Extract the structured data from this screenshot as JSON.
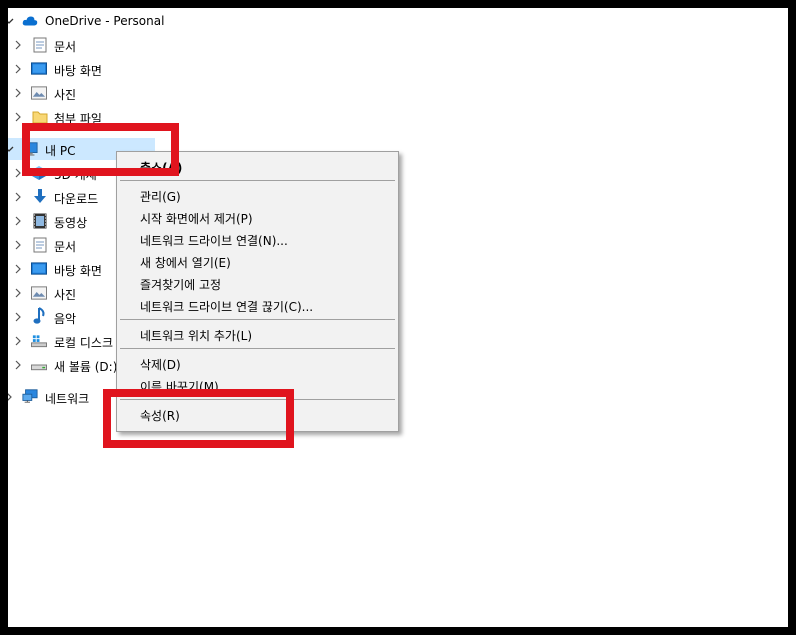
{
  "nav": {
    "items": [
      {
        "label": "OneDrive - Personal",
        "icon": "cloud-icon",
        "chevron": "expanded"
      },
      {
        "label": "문서",
        "icon": "document-icon",
        "chevron": "collapsed"
      },
      {
        "label": "바탕 화면",
        "icon": "desktop-icon",
        "chevron": "collapsed"
      },
      {
        "label": "사진",
        "icon": "pictures-icon",
        "chevron": "collapsed"
      },
      {
        "label": "첨부 파일",
        "icon": "folder-icon",
        "chevron": "collapsed"
      },
      {
        "label": "내 PC",
        "icon": "computer-icon",
        "chevron": "expanded",
        "selected": true
      },
      {
        "label": "3D 개체",
        "icon": "3d-objects-icon",
        "chevron": "collapsed"
      },
      {
        "label": "다운로드",
        "icon": "download-icon",
        "chevron": "collapsed"
      },
      {
        "label": "동영상",
        "icon": "video-icon",
        "chevron": "collapsed"
      },
      {
        "label": "문서",
        "icon": "document-icon",
        "chevron": "collapsed"
      },
      {
        "label": "바탕 화면",
        "icon": "desktop-icon",
        "chevron": "collapsed"
      },
      {
        "label": "사진",
        "icon": "pictures-icon",
        "chevron": "collapsed"
      },
      {
        "label": "음악",
        "icon": "music-icon",
        "chevron": "collapsed"
      },
      {
        "label": "로컬 디스크 (C:)",
        "icon": "windows-drive-icon",
        "chevron": "collapsed"
      },
      {
        "label": "새 볼륨 (D:)",
        "icon": "drive-icon",
        "chevron": "collapsed"
      },
      {
        "label": "네트워크",
        "icon": "network-icon",
        "chevron": "collapsed"
      }
    ]
  },
  "context_menu": {
    "items": [
      {
        "label": "축소(A)",
        "bold": true
      },
      {
        "label": "관리(G)"
      },
      {
        "label": "시작 화면에서 제거(P)"
      },
      {
        "label": "네트워크 드라이브 연결(N)..."
      },
      {
        "label": "새 창에서 열기(E)"
      },
      {
        "label": "즐겨찾기에 고정"
      },
      {
        "label": "네트워크 드라이브 연결 끊기(C)..."
      },
      {
        "label": "네트워크 위치 추가(L)"
      },
      {
        "label": "삭제(D)"
      },
      {
        "label": "이름 바꾸기(M)"
      },
      {
        "label": "속성(R)"
      }
    ]
  },
  "colors": {
    "highlight_box": "#e0141e",
    "selection": "#cce8ff",
    "menu_background": "#f2f2f2"
  }
}
